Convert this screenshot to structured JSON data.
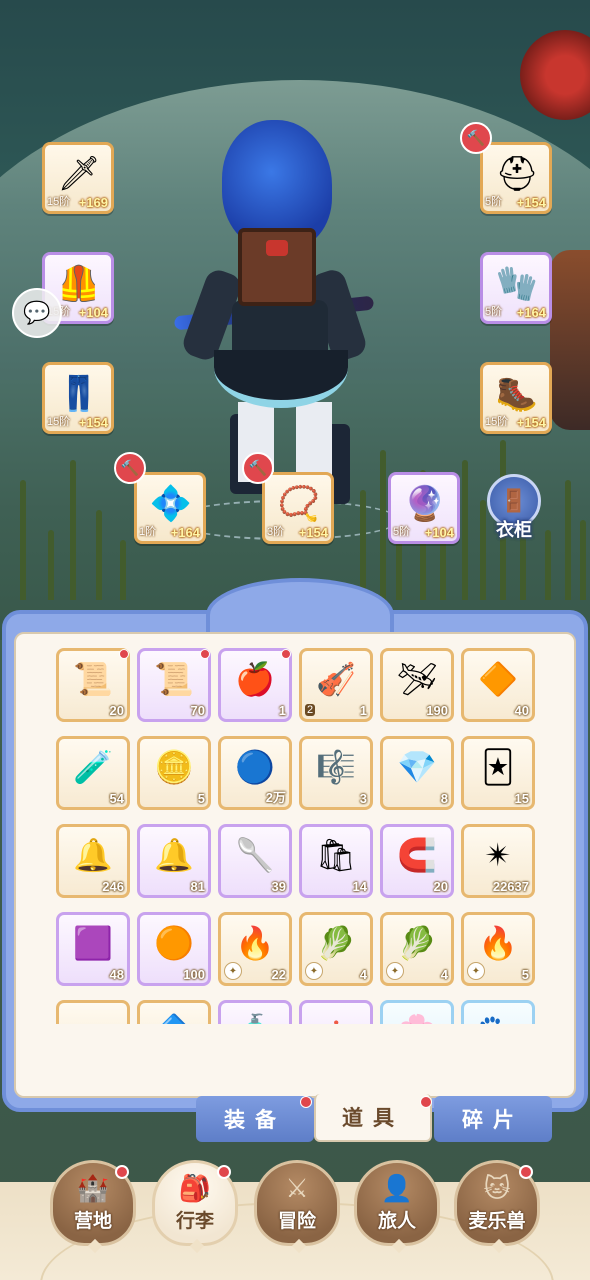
{
  "equipment": {
    "left": [
      {
        "name": "weapon-slot",
        "tier": "15阶",
        "bonus": "+169",
        "icon": "sword-icon",
        "glyph": "🗡"
      },
      {
        "name": "armor-slot",
        "tier": "15阶",
        "bonus": "+104",
        "icon": "armor-icon",
        "glyph": "🦺"
      },
      {
        "name": "pants-slot",
        "tier": "15阶",
        "bonus": "+154",
        "icon": "pants-icon",
        "glyph": "👖"
      }
    ],
    "right": [
      {
        "name": "helmet-slot",
        "tier": "5阶",
        "bonus": "+154",
        "icon": "helmet-icon",
        "glyph": "⛑"
      },
      {
        "name": "gauntlet-slot",
        "tier": "5阶",
        "bonus": "+164",
        "icon": "gauntlet-icon",
        "glyph": "🧤"
      },
      {
        "name": "boots-slot",
        "tier": "15阶",
        "bonus": "+154",
        "icon": "boots-icon",
        "glyph": "🥾"
      }
    ],
    "bottom": [
      {
        "name": "ring-slot",
        "tier": "1阶",
        "bonus": "+164",
        "icon": "ring-icon",
        "glyph": "💠"
      },
      {
        "name": "necklace-slot",
        "tier": "3阶",
        "bonus": "+154",
        "icon": "necklace-icon",
        "glyph": "📿"
      },
      {
        "name": "charm-slot",
        "tier": "5阶",
        "bonus": "+104",
        "icon": "charm-icon",
        "glyph": "🔮"
      }
    ]
  },
  "wardrobe": {
    "label": "衣柜",
    "icon": "wardrobe-icon"
  },
  "chat": {
    "icon": "chat-bubble-icon"
  },
  "items": [
    {
      "count": "20",
      "rarity": "gold",
      "glyph": "📜",
      "icon": "scroll-icon",
      "dot": true
    },
    {
      "count": "70",
      "rarity": "purple",
      "glyph": "📜",
      "icon": "purple-scroll-icon",
      "dot": true
    },
    {
      "count": "1",
      "rarity": "purple",
      "glyph": "🍎",
      "icon": "apple-icon",
      "dot": true
    },
    {
      "count": "1",
      "rarity": "gold",
      "glyph": "🎻",
      "icon": "instrument-icon",
      "tag": "2",
      "dot": false
    },
    {
      "count": "190",
      "rarity": "gold",
      "glyph": "🛩",
      "icon": "paper-plane-icon",
      "dot": false
    },
    {
      "count": "40",
      "rarity": "gold",
      "glyph": "🔶",
      "icon": "gold-crystal-icon",
      "dot": false
    },
    {
      "count": "54",
      "rarity": "gold",
      "glyph": "🧪",
      "icon": "potion-icon",
      "dot": false
    },
    {
      "count": "5",
      "rarity": "gold",
      "glyph": "🪙",
      "icon": "cat-coin-icon",
      "dot": false
    },
    {
      "count": "2万",
      "rarity": "gold",
      "glyph": "🔵",
      "icon": "star-orb-icon",
      "dot": false
    },
    {
      "count": "3",
      "rarity": "gold",
      "glyph": "🎼",
      "icon": "lyre-icon",
      "dot": false
    },
    {
      "count": "8",
      "rarity": "gold",
      "glyph": "💎",
      "icon": "blue-ore-icon",
      "dot": false
    },
    {
      "count": "15",
      "rarity": "gold",
      "glyph": "🃏",
      "icon": "card-icon",
      "dot": false
    },
    {
      "count": "246",
      "rarity": "gold",
      "glyph": "🔔",
      "icon": "bell-icon",
      "dot": false
    },
    {
      "count": "81",
      "rarity": "purple",
      "glyph": "🔔",
      "icon": "gold-bell-icon",
      "dot": false
    },
    {
      "count": "39",
      "rarity": "purple",
      "glyph": "🥄",
      "icon": "spoon-icon",
      "dot": false
    },
    {
      "count": "14",
      "rarity": "purple",
      "glyph": "🛍",
      "icon": "pouch-icon",
      "dot": false
    },
    {
      "count": "20",
      "rarity": "purple",
      "glyph": "🧲",
      "icon": "horseshoe-icon",
      "dot": false
    },
    {
      "count": "22637",
      "rarity": "gold",
      "glyph": "✴",
      "icon": "star-crystal-icon",
      "dot": false
    },
    {
      "count": "48",
      "rarity": "purple",
      "glyph": "🟪",
      "icon": "purple-gem-icon",
      "dot": false
    },
    {
      "count": "100",
      "rarity": "purple",
      "glyph": "🟠",
      "icon": "amber-gem-icon",
      "dot": false
    },
    {
      "count": "22",
      "rarity": "gold",
      "glyph": "🔥",
      "icon": "fire-crystal-icon",
      "sub": true,
      "dot": false
    },
    {
      "count": "4",
      "rarity": "gold",
      "glyph": "🥬",
      "icon": "leaf-seed-icon",
      "sub": true,
      "dot": false
    },
    {
      "count": "4",
      "rarity": "gold",
      "glyph": "🥬",
      "icon": "leaf-seed-icon",
      "sub": true,
      "dot": false
    },
    {
      "count": "5",
      "rarity": "gold",
      "glyph": "🔥",
      "icon": "fire-crystal-icon",
      "sub": true,
      "dot": false
    },
    {
      "count": "",
      "rarity": "gold",
      "glyph": "🔸",
      "icon": "ore-icon",
      "dot": false
    },
    {
      "count": "",
      "rarity": "gold",
      "glyph": "🔷",
      "icon": "crystal-icon",
      "dot": false
    },
    {
      "count": "",
      "rarity": "purple",
      "glyph": "🧴",
      "icon": "bottle-icon",
      "dot": false
    },
    {
      "count": "",
      "rarity": "purple",
      "glyph": "🫖",
      "icon": "kettle-icon",
      "dot": false
    },
    {
      "count": "",
      "rarity": "blue",
      "glyph": "🌸",
      "icon": "flower-icon",
      "dot": false
    },
    {
      "count": "",
      "rarity": "blue",
      "glyph": "🐾",
      "icon": "paw-icon",
      "dot": false
    }
  ],
  "tabs": [
    {
      "label": "装备",
      "active": false,
      "dot": true
    },
    {
      "label": "道具",
      "active": true,
      "dot": true
    },
    {
      "label": "碎片",
      "active": false,
      "dot": false
    }
  ],
  "nav": [
    {
      "label": "营地",
      "icon": "castle-icon",
      "glyph": "🏰",
      "active": false,
      "dot": true
    },
    {
      "label": "行李",
      "icon": "backpack-icon",
      "glyph": "🎒",
      "active": true,
      "dot": true
    },
    {
      "label": "冒险",
      "icon": "crossed-swords-icon",
      "glyph": "⚔",
      "active": false,
      "dot": false
    },
    {
      "label": "旅人",
      "icon": "traveler-icon",
      "glyph": "👤",
      "active": false,
      "dot": false
    },
    {
      "label": "麦乐兽",
      "icon": "pet-icon",
      "glyph": "🐱",
      "active": false,
      "dot": true
    }
  ]
}
